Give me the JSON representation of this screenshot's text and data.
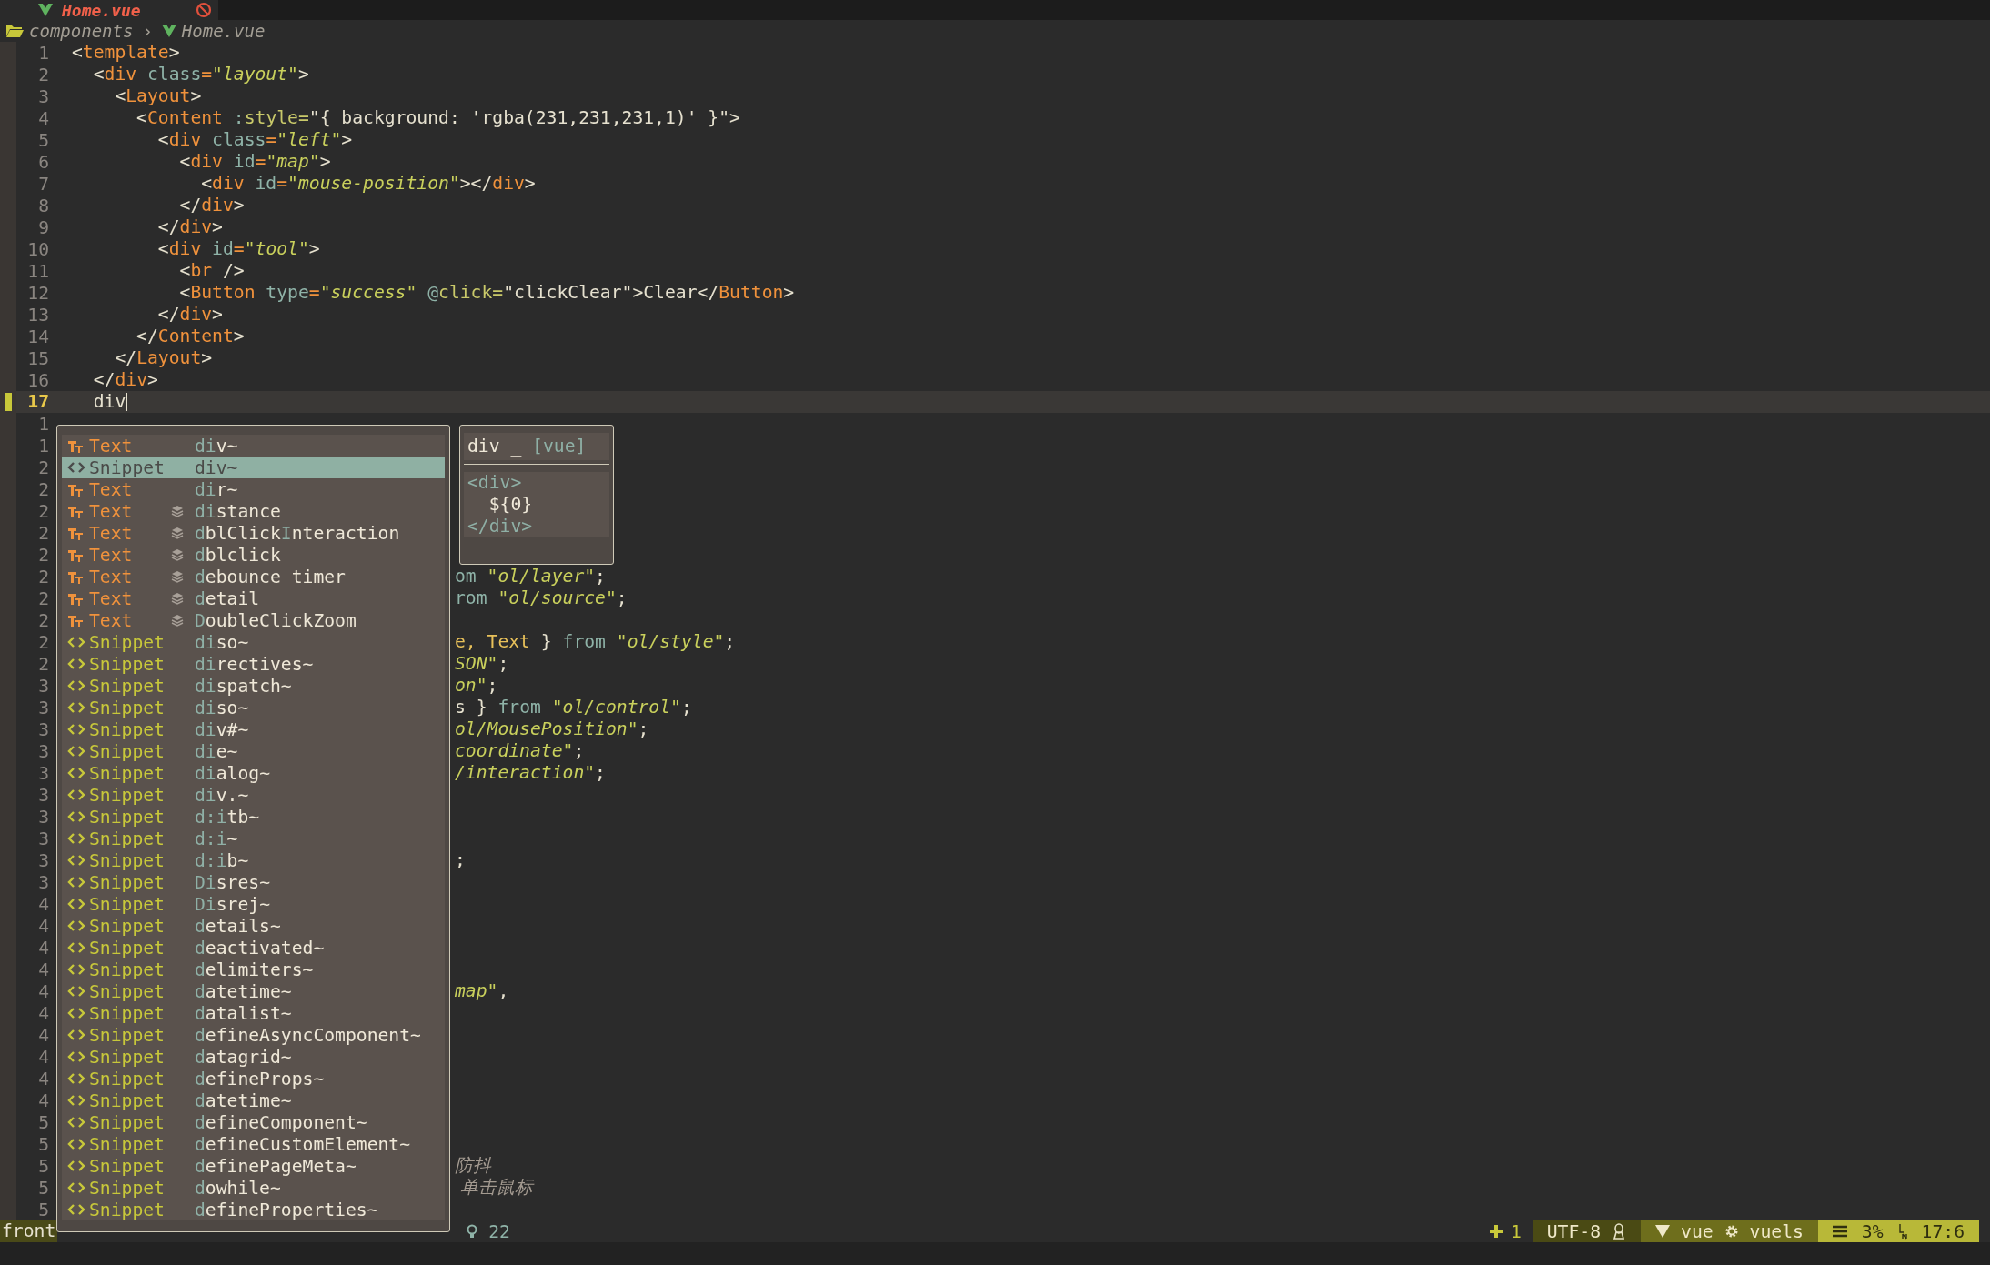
{
  "tabline": {
    "tab": {
      "title": "Home.vue",
      "has_error": true
    }
  },
  "breadcrumb": [
    {
      "kind": "folder",
      "text": "components"
    },
    {
      "kind": "separator",
      "text": "›"
    },
    {
      "kind": "vue",
      "text": "Home.vue"
    }
  ],
  "lines": [
    {
      "number": "1",
      "current": false,
      "tokens": [
        {
          "kind": "punct",
          "text": "<"
        },
        {
          "kind": "tag",
          "text": "template"
        },
        {
          "kind": "punct",
          "text": ">"
        }
      ]
    },
    {
      "number": "2",
      "current": false,
      "tokens": [
        {
          "kind": "punct",
          "text": "  <"
        },
        {
          "kind": "tag",
          "text": "div"
        },
        {
          "kind": "attr",
          "text": " class"
        },
        {
          "kind": "tag",
          "text": "="
        },
        {
          "kind": "string",
          "text": "\"layout\""
        },
        {
          "kind": "punct",
          "text": ">"
        }
      ]
    },
    {
      "number": "3",
      "current": false,
      "tokens": [
        {
          "kind": "punct",
          "text": "    <"
        },
        {
          "kind": "tag",
          "text": "Layout"
        },
        {
          "kind": "punct",
          "text": ">"
        }
      ]
    },
    {
      "number": "4",
      "current": false,
      "tokens": [
        {
          "kind": "punct",
          "text": "      <"
        },
        {
          "kind": "tag",
          "text": "Content"
        },
        {
          "kind": "attr",
          "text": " :"
        },
        {
          "kind": "directive",
          "text": "style="
        },
        {
          "kind": "punct",
          "text": "\"{ background: 'rgba(231,231,231,1)' }\">"
        }
      ]
    },
    {
      "number": "5",
      "current": false,
      "tokens": [
        {
          "kind": "punct",
          "text": "        <"
        },
        {
          "kind": "tag",
          "text": "div"
        },
        {
          "kind": "attr",
          "text": " class"
        },
        {
          "kind": "tag",
          "text": "="
        },
        {
          "kind": "string",
          "text": "\"left\""
        },
        {
          "kind": "punct",
          "text": ">"
        }
      ]
    },
    {
      "number": "6",
      "current": false,
      "tokens": [
        {
          "kind": "punct",
          "text": "          <"
        },
        {
          "kind": "tag",
          "text": "div"
        },
        {
          "kind": "attr",
          "text": " id"
        },
        {
          "kind": "tag",
          "text": "="
        },
        {
          "kind": "string",
          "text": "\"map\""
        },
        {
          "kind": "punct",
          "text": ">"
        }
      ]
    },
    {
      "number": "7",
      "current": false,
      "tokens": [
        {
          "kind": "punct",
          "text": "            <"
        },
        {
          "kind": "tag",
          "text": "div"
        },
        {
          "kind": "attr",
          "text": " id"
        },
        {
          "kind": "tag",
          "text": "="
        },
        {
          "kind": "string",
          "text": "\"mouse-position\""
        },
        {
          "kind": "punct",
          "text": "></"
        },
        {
          "kind": "tag",
          "text": "div"
        },
        {
          "kind": "punct",
          "text": ">"
        }
      ]
    },
    {
      "number": "8",
      "current": false,
      "tokens": [
        {
          "kind": "punct",
          "text": "          </"
        },
        {
          "kind": "tag",
          "text": "div"
        },
        {
          "kind": "punct",
          "text": ">"
        }
      ]
    },
    {
      "number": "9",
      "current": false,
      "tokens": [
        {
          "kind": "punct",
          "text": "        </"
        },
        {
          "kind": "tag",
          "text": "div"
        },
        {
          "kind": "punct",
          "text": ">"
        }
      ]
    },
    {
      "number": "10",
      "current": false,
      "tokens": [
        {
          "kind": "punct",
          "text": "        <"
        },
        {
          "kind": "tag",
          "text": "div"
        },
        {
          "kind": "attr",
          "text": " id"
        },
        {
          "kind": "tag",
          "text": "="
        },
        {
          "kind": "string",
          "text": "\"tool\""
        },
        {
          "kind": "punct",
          "text": ">"
        }
      ]
    },
    {
      "number": "11",
      "current": false,
      "tokens": [
        {
          "kind": "punct",
          "text": "          <"
        },
        {
          "kind": "tag",
          "text": "br"
        },
        {
          "kind": "punct",
          "text": " />"
        }
      ]
    },
    {
      "number": "12",
      "current": false,
      "tokens": [
        {
          "kind": "punct",
          "text": "          <"
        },
        {
          "kind": "tag",
          "text": "Button"
        },
        {
          "kind": "attr",
          "text": " type"
        },
        {
          "kind": "tag",
          "text": "="
        },
        {
          "kind": "string",
          "text": "\"success\""
        },
        {
          "kind": "attr",
          "text": " @"
        },
        {
          "kind": "directive",
          "text": "click="
        },
        {
          "kind": "punct",
          "text": "\"clickClear\">Clear</"
        },
        {
          "kind": "tag",
          "text": "Button"
        },
        {
          "kind": "punct",
          "text": ">"
        }
      ]
    },
    {
      "number": "13",
      "current": false,
      "tokens": [
        {
          "kind": "punct",
          "text": "        </"
        },
        {
          "kind": "tag",
          "text": "div"
        },
        {
          "kind": "punct",
          "text": ">"
        }
      ]
    },
    {
      "number": "14",
      "current": false,
      "tokens": [
        {
          "kind": "punct",
          "text": "      </"
        },
        {
          "kind": "tag",
          "text": "Content"
        },
        {
          "kind": "punct",
          "text": ">"
        }
      ]
    },
    {
      "number": "15",
      "current": false,
      "tokens": [
        {
          "kind": "punct",
          "text": "    </"
        },
        {
          "kind": "tag",
          "text": "Layout"
        },
        {
          "kind": "punct",
          "text": ">"
        }
      ]
    },
    {
      "number": "16",
      "current": false,
      "tokens": [
        {
          "kind": "punct",
          "text": "  </"
        },
        {
          "kind": "tag",
          "text": "div"
        },
        {
          "kind": "punct",
          "text": ">"
        }
      ]
    },
    {
      "number": "17",
      "current": true,
      "tokens": [
        {
          "kind": "text",
          "text": "  div"
        }
      ]
    }
  ],
  "covered_lines": [
    {
      "number": "1"
    },
    {
      "number": "1"
    },
    {
      "number": "2"
    },
    {
      "number": "2"
    },
    {
      "number": "2"
    },
    {
      "number": "2"
    },
    {
      "number": "2"
    },
    {
      "number": "2",
      "tail": [
        {
          "kind": "keyword",
          "text": "om "
        },
        {
          "kind": "string",
          "text": "\"ol/layer\""
        },
        {
          "kind": "punct",
          "text": ";"
        }
      ]
    },
    {
      "number": "2",
      "tail": [
        {
          "kind": "keyword",
          "text": "rom "
        },
        {
          "kind": "string",
          "text": "\"ol/source\""
        },
        {
          "kind": "punct",
          "text": ";"
        }
      ]
    },
    {
      "number": "2"
    },
    {
      "number": "2",
      "tail": [
        {
          "kind": "type",
          "text": "e, Text"
        },
        {
          "kind": "punct",
          "text": " } "
        },
        {
          "kind": "keyword",
          "text": "from "
        },
        {
          "kind": "string",
          "text": "\"ol/style\""
        },
        {
          "kind": "punct",
          "text": ";"
        }
      ]
    },
    {
      "number": "2",
      "tail": [
        {
          "kind": "string",
          "text": "SON\""
        },
        {
          "kind": "punct",
          "text": ";"
        }
      ]
    },
    {
      "number": "3",
      "tail": [
        {
          "kind": "string",
          "text": "on\""
        },
        {
          "kind": "punct",
          "text": ";"
        }
      ]
    },
    {
      "number": "3",
      "tail": [
        {
          "kind": "punct",
          "text": "s } "
        },
        {
          "kind": "keyword",
          "text": "from "
        },
        {
          "kind": "string",
          "text": "\"ol/control\""
        },
        {
          "kind": "punct",
          "text": ";"
        }
      ]
    },
    {
      "number": "3",
      "tail": [
        {
          "kind": "string",
          "text": "ol/MousePosition\""
        },
        {
          "kind": "punct",
          "text": ";"
        }
      ]
    },
    {
      "number": "3",
      "tail": [
        {
          "kind": "string",
          "text": "coordinate\""
        },
        {
          "kind": "punct",
          "text": ";"
        }
      ]
    },
    {
      "number": "3",
      "tail": [
        {
          "kind": "string",
          "text": "/interaction\""
        },
        {
          "kind": "punct",
          "text": ";"
        }
      ]
    },
    {
      "number": "3"
    },
    {
      "number": "3"
    },
    {
      "number": "3"
    },
    {
      "number": "3",
      "tail": [
        {
          "kind": "punct",
          "text": ";"
        }
      ]
    },
    {
      "number": "3"
    },
    {
      "number": "4"
    },
    {
      "number": "4"
    },
    {
      "number": "4"
    },
    {
      "number": "4"
    },
    {
      "number": "4",
      "tail": [
        {
          "kind": "string",
          "text": "map\""
        },
        {
          "kind": "punct",
          "text": ","
        }
      ]
    },
    {
      "number": "4"
    },
    {
      "number": "4"
    },
    {
      "number": "4"
    },
    {
      "number": "4"
    },
    {
      "number": "4"
    },
    {
      "number": "5"
    },
    {
      "number": "5"
    },
    {
      "number": "5",
      "tail": [
        {
          "kind": "comment",
          "text": "防抖"
        }
      ]
    },
    {
      "number": "5",
      "tail": [
        {
          "kind": "comment",
          "text": " 单击鼠标"
        }
      ]
    },
    {
      "number": "5"
    }
  ],
  "popup": {
    "items": [
      {
        "kind": "text",
        "label": "Text",
        "layers": false,
        "selected": false,
        "parts": [
          {
            "text": "di",
            "matched": true
          },
          {
            "text": "v~",
            "matched": false
          }
        ]
      },
      {
        "kind": "snippet",
        "label": "Snippet",
        "layers": false,
        "selected": true,
        "parts": [
          {
            "text": "div~",
            "matched": false
          }
        ]
      },
      {
        "kind": "text",
        "label": "Text",
        "layers": false,
        "selected": false,
        "parts": [
          {
            "text": "di",
            "matched": true
          },
          {
            "text": "r~",
            "matched": false
          }
        ]
      },
      {
        "kind": "text",
        "label": "Text",
        "layers": true,
        "selected": false,
        "parts": [
          {
            "text": "di",
            "matched": true
          },
          {
            "text": "stance",
            "matched": false
          }
        ]
      },
      {
        "kind": "text",
        "label": "Text",
        "layers": true,
        "selected": false,
        "parts": [
          {
            "text": "d",
            "matched": true
          },
          {
            "text": "blClick",
            "matched": false
          },
          {
            "text": "I",
            "matched": true
          },
          {
            "text": "nteraction",
            "matched": false
          }
        ]
      },
      {
        "kind": "text",
        "label": "Text",
        "layers": true,
        "selected": false,
        "parts": [
          {
            "text": "d",
            "matched": true
          },
          {
            "text": "blclick",
            "matched": false
          }
        ]
      },
      {
        "kind": "text",
        "label": "Text",
        "layers": true,
        "selected": false,
        "parts": [
          {
            "text": "d",
            "matched": true
          },
          {
            "text": "ebounce_timer",
            "matched": false
          }
        ]
      },
      {
        "kind": "text",
        "label": "Text",
        "layers": true,
        "selected": false,
        "parts": [
          {
            "text": "d",
            "matched": true
          },
          {
            "text": "etail",
            "matched": false
          }
        ]
      },
      {
        "kind": "text",
        "label": "Text",
        "layers": true,
        "selected": false,
        "parts": [
          {
            "text": "D",
            "matched": true
          },
          {
            "text": "oubleClickZoom",
            "matched": false
          }
        ]
      },
      {
        "kind": "snippet",
        "label": "Snippet",
        "layers": false,
        "selected": false,
        "parts": [
          {
            "text": "di",
            "matched": true
          },
          {
            "text": "so~",
            "matched": false
          }
        ]
      },
      {
        "kind": "snippet",
        "label": "Snippet",
        "layers": false,
        "selected": false,
        "parts": [
          {
            "text": "di",
            "matched": true
          },
          {
            "text": "rectives~",
            "matched": false
          }
        ]
      },
      {
        "kind": "snippet",
        "label": "Snippet",
        "layers": false,
        "selected": false,
        "parts": [
          {
            "text": "di",
            "matched": true
          },
          {
            "text": "spatch~",
            "matched": false
          }
        ]
      },
      {
        "kind": "snippet",
        "label": "Snippet",
        "layers": false,
        "selected": false,
        "parts": [
          {
            "text": "di",
            "matched": true
          },
          {
            "text": "so~",
            "matched": false
          }
        ]
      },
      {
        "kind": "snippet",
        "label": "Snippet",
        "layers": false,
        "selected": false,
        "parts": [
          {
            "text": "di",
            "matched": true
          },
          {
            "text": "v#~",
            "matched": false
          }
        ]
      },
      {
        "kind": "snippet",
        "label": "Snippet",
        "layers": false,
        "selected": false,
        "parts": [
          {
            "text": "di",
            "matched": true
          },
          {
            "text": "e~",
            "matched": false
          }
        ]
      },
      {
        "kind": "snippet",
        "label": "Snippet",
        "layers": false,
        "selected": false,
        "parts": [
          {
            "text": "di",
            "matched": true
          },
          {
            "text": "alog~",
            "matched": false
          }
        ]
      },
      {
        "kind": "snippet",
        "label": "Snippet",
        "layers": false,
        "selected": false,
        "parts": [
          {
            "text": "di",
            "matched": true
          },
          {
            "text": "v.~",
            "matched": false
          }
        ]
      },
      {
        "kind": "snippet",
        "label": "Snippet",
        "layers": false,
        "selected": false,
        "parts": [
          {
            "text": "d:i",
            "matched": true
          },
          {
            "text": "tb~",
            "matched": false
          }
        ]
      },
      {
        "kind": "snippet",
        "label": "Snippet",
        "layers": false,
        "selected": false,
        "parts": [
          {
            "text": "d:i",
            "matched": true
          },
          {
            "text": "~",
            "matched": false
          }
        ]
      },
      {
        "kind": "snippet",
        "label": "Snippet",
        "layers": false,
        "selected": false,
        "parts": [
          {
            "text": "d:i",
            "matched": true
          },
          {
            "text": "b~",
            "matched": false
          }
        ]
      },
      {
        "kind": "snippet",
        "label": "Snippet",
        "layers": false,
        "selected": false,
        "parts": [
          {
            "text": "Di",
            "matched": true
          },
          {
            "text": "sres~",
            "matched": false
          }
        ]
      },
      {
        "kind": "snippet",
        "label": "Snippet",
        "layers": false,
        "selected": false,
        "parts": [
          {
            "text": "Di",
            "matched": true
          },
          {
            "text": "srej~",
            "matched": false
          }
        ]
      },
      {
        "kind": "snippet",
        "label": "Snippet",
        "layers": false,
        "selected": false,
        "parts": [
          {
            "text": "d",
            "matched": true
          },
          {
            "text": "etails~",
            "matched": false
          }
        ]
      },
      {
        "kind": "snippet",
        "label": "Snippet",
        "layers": false,
        "selected": false,
        "parts": [
          {
            "text": "d",
            "matched": true
          },
          {
            "text": "eactivated~",
            "matched": false
          }
        ]
      },
      {
        "kind": "snippet",
        "label": "Snippet",
        "layers": false,
        "selected": false,
        "parts": [
          {
            "text": "d",
            "matched": true
          },
          {
            "text": "elimiters~",
            "matched": false
          }
        ]
      },
      {
        "kind": "snippet",
        "label": "Snippet",
        "layers": false,
        "selected": false,
        "parts": [
          {
            "text": "d",
            "matched": true
          },
          {
            "text": "atetime~",
            "matched": false
          }
        ]
      },
      {
        "kind": "snippet",
        "label": "Snippet",
        "layers": false,
        "selected": false,
        "parts": [
          {
            "text": "d",
            "matched": true
          },
          {
            "text": "atalist~",
            "matched": false
          }
        ]
      },
      {
        "kind": "snippet",
        "label": "Snippet",
        "layers": false,
        "selected": false,
        "parts": [
          {
            "text": "d",
            "matched": true
          },
          {
            "text": "efineAsyncComponent~",
            "matched": false
          }
        ]
      },
      {
        "kind": "snippet",
        "label": "Snippet",
        "layers": false,
        "selected": false,
        "parts": [
          {
            "text": "d",
            "matched": true
          },
          {
            "text": "atagrid~",
            "matched": false
          }
        ]
      },
      {
        "kind": "snippet",
        "label": "Snippet",
        "layers": false,
        "selected": false,
        "parts": [
          {
            "text": "d",
            "matched": true
          },
          {
            "text": "efineProps~",
            "matched": false
          }
        ]
      },
      {
        "kind": "snippet",
        "label": "Snippet",
        "layers": false,
        "selected": false,
        "parts": [
          {
            "text": "d",
            "matched": true
          },
          {
            "text": "atetime~",
            "matched": false
          }
        ]
      },
      {
        "kind": "snippet",
        "label": "Snippet",
        "layers": false,
        "selected": false,
        "parts": [
          {
            "text": "d",
            "matched": true
          },
          {
            "text": "efineComponent~",
            "matched": false
          }
        ]
      },
      {
        "kind": "snippet",
        "label": "Snippet",
        "layers": false,
        "selected": false,
        "parts": [
          {
            "text": "d",
            "matched": true
          },
          {
            "text": "efineCustomElement~",
            "matched": false
          }
        ]
      },
      {
        "kind": "snippet",
        "label": "Snippet",
        "layers": false,
        "selected": false,
        "parts": [
          {
            "text": "d",
            "matched": true
          },
          {
            "text": "efinePageMeta~",
            "matched": false
          }
        ]
      },
      {
        "kind": "snippet",
        "label": "Snippet",
        "layers": false,
        "selected": false,
        "parts": [
          {
            "text": "d",
            "matched": true
          },
          {
            "text": "owhile~",
            "matched": false
          }
        ]
      },
      {
        "kind": "snippet",
        "label": "Snippet",
        "layers": false,
        "selected": false,
        "parts": [
          {
            "text": "d",
            "matched": true
          },
          {
            "text": "efineProperties~",
            "matched": false
          }
        ]
      }
    ]
  },
  "preview": {
    "name": "div _",
    "filetype": "[vue]",
    "body": [
      {
        "kind": "tag",
        "text": "<div>"
      },
      {
        "kind": "text",
        "text": "  ${0}"
      },
      {
        "kind": "tag",
        "text": "</div>"
      }
    ]
  },
  "status_bar": {
    "mode": "front",
    "diagnostics": "22",
    "changes": "1",
    "encoding": "UTF-8",
    "filetype": "vue",
    "language_server": "vuels",
    "percent": "3%",
    "position": "17:6"
  }
}
